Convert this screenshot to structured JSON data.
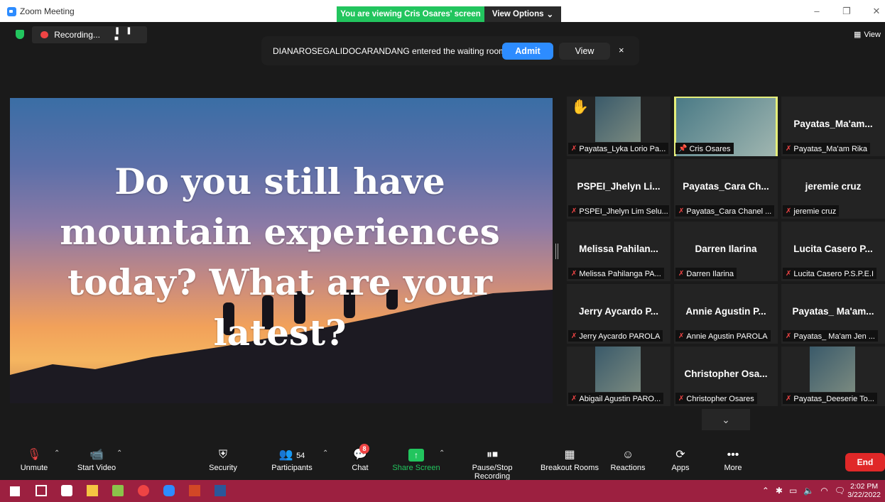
{
  "window": {
    "title": "Zoom Meeting",
    "viewing_banner": "You are viewing Cris Osares' screen",
    "view_options": "View Options",
    "view_label": "View"
  },
  "recording": {
    "label": "Recording..."
  },
  "notice": {
    "text": "DIANAROSEGALIDOCARANDANG entered the waiting room",
    "admit": "Admit",
    "view": "View",
    "close": "×"
  },
  "slide": {
    "text": "Do you still have mountain experiences today? What are your latest?"
  },
  "tiles": [
    {
      "display": "",
      "label": "Payatas_Lyka Lorio Pa...",
      "has_video": true,
      "raised_hand": true
    },
    {
      "display": "",
      "label": "Cris Osares",
      "has_video": true,
      "active_speaker": true
    },
    {
      "display": "Payatas_Ma'am...",
      "label": "Payatas_Ma'am Rika"
    },
    {
      "display": "PSPEI_Jhelyn Li...",
      "label": "PSPEI_Jhelyn Lim Selu..."
    },
    {
      "display": "Payatas_Cara Ch...",
      "label": "Payatas_Cara Chanel ..."
    },
    {
      "display": "jeremie cruz",
      "label": "jeremie cruz"
    },
    {
      "display": "Melissa Pahilan...",
      "label": "Melissa Pahilanga PA..."
    },
    {
      "display": "Darren Ilarina",
      "label": "Darren Ilarina"
    },
    {
      "display": "Lucita Casero P...",
      "label": "Lucita Casero P.S.P.E.I"
    },
    {
      "display": "Jerry Aycardo P...",
      "label": "Jerry Aycardo PAROLA"
    },
    {
      "display": "Annie Agustin P...",
      "label": "Annie Agustin PAROLA"
    },
    {
      "display": "Payatas_ Ma'am...",
      "label": "Payatas_ Ma'am Jen ..."
    },
    {
      "display": "",
      "label": "Abigail Agustin PARO...",
      "has_video": true
    },
    {
      "display": "Christopher Osa...",
      "label": "Christopher Osares"
    },
    {
      "display": "",
      "label": "Payatas_Deeserie To...",
      "has_video": true
    }
  ],
  "toolbar": {
    "unmute": "Unmute",
    "start_video": "Start Video",
    "security": "Security",
    "participants": "Participants",
    "participants_count": "54",
    "chat": "Chat",
    "chat_badge": "8",
    "share_screen": "Share Screen",
    "pause_stop_recording": "Pause/Stop Recording",
    "breakout_rooms": "Breakout Rooms",
    "reactions": "Reactions",
    "apps": "Apps",
    "more": "More",
    "end": "End"
  },
  "taskbar": {
    "time": "2:02 PM",
    "date": "3/22/2022"
  },
  "colors": {
    "share_green": "#22c55e",
    "zoom_blue": "#2d8cff",
    "end_red": "#e02828",
    "taskbar": "#9c2040"
  }
}
